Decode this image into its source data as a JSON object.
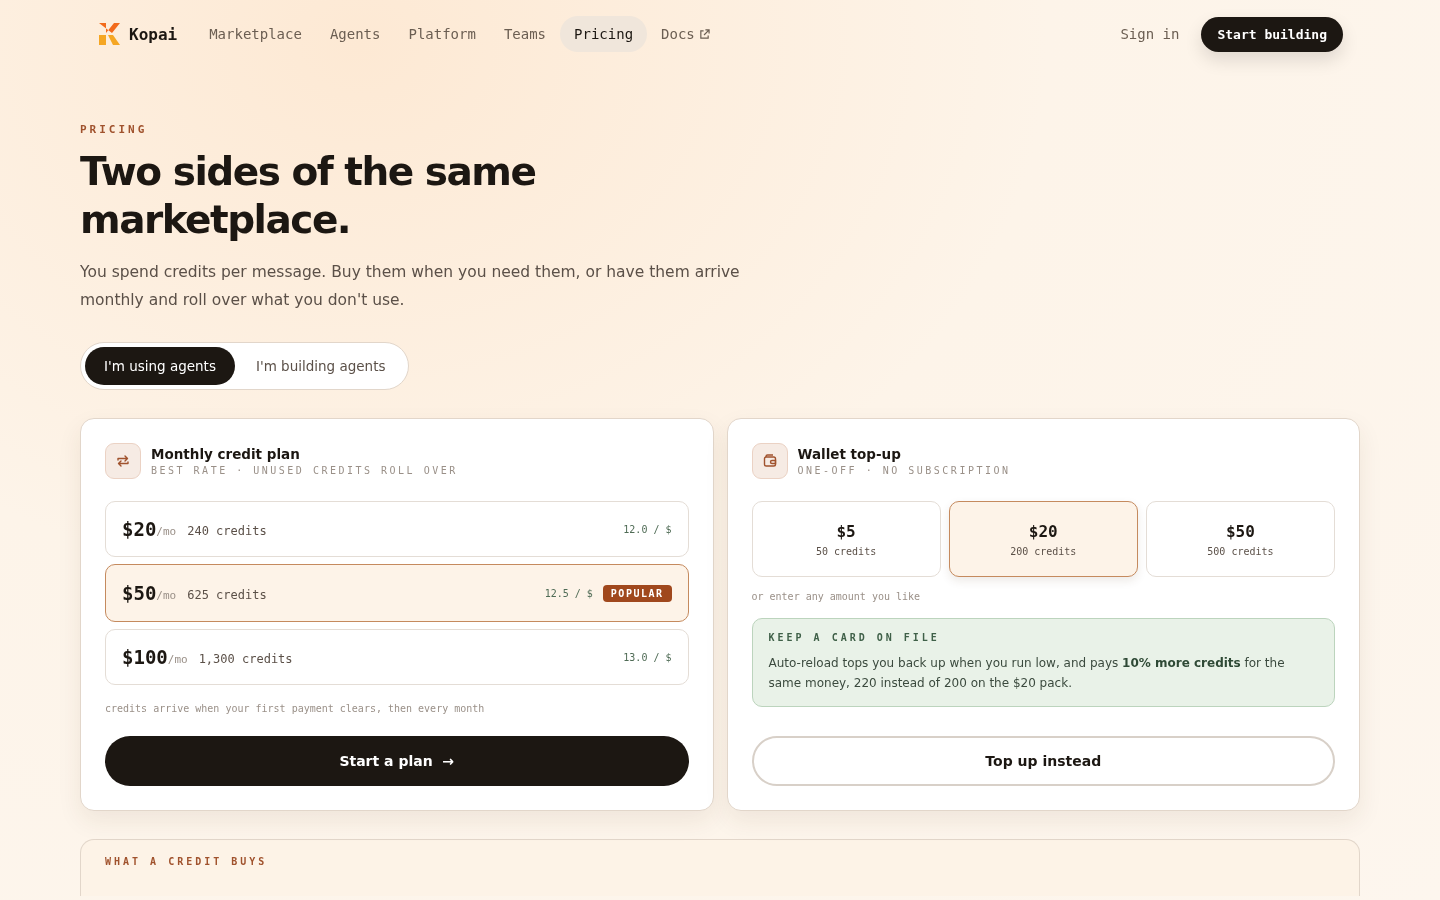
{
  "nav": {
    "brand": "Kopai",
    "links": [
      {
        "label": "Marketplace",
        "selected": false,
        "external": false
      },
      {
        "label": "Agents",
        "selected": false,
        "external": false
      },
      {
        "label": "Platform",
        "selected": false,
        "external": false
      },
      {
        "label": "Teams",
        "selected": false,
        "external": false
      },
      {
        "label": "Pricing",
        "selected": true,
        "external": false
      },
      {
        "label": "Docs",
        "selected": false,
        "external": true
      }
    ],
    "sign_in": "Sign in",
    "cta": "Start building"
  },
  "hero": {
    "eyebrow": "PRICING",
    "title": "Two sides of the same marketplace.",
    "lead": "You spend credits per message. Buy them when you need them, or have them arrive monthly and roll over what you don't use."
  },
  "audience_tabs": [
    {
      "label": "I'm using agents",
      "selected": true
    },
    {
      "label": "I'm building agents",
      "selected": false
    }
  ],
  "plan_card": {
    "title": "Monthly credit plan",
    "subtitle": "BEST RATE · UNUSED CREDITS ROLL OVER",
    "plans": [
      {
        "price": "$20",
        "period": "/mo",
        "credits": "240 credits",
        "rate": "12.0 / $",
        "selected": false
      },
      {
        "price": "$50",
        "period": "/mo",
        "credits": "625 credits",
        "rate": "12.5 / $",
        "badge": "POPULAR",
        "selected": true
      },
      {
        "price": "$100",
        "period": "/mo",
        "credits": "1,300 credits",
        "rate": "13.0 / $",
        "selected": false
      }
    ],
    "note": "credits arrive when your first payment clears, then every month",
    "button": "Start a plan",
    "button_arrow": "→"
  },
  "wallet_card": {
    "title": "Wallet top-up",
    "subtitle": "ONE-OFF · NO SUBSCRIPTION",
    "packs": [
      {
        "price": "$5",
        "credits": "50 credits",
        "selected": false
      },
      {
        "price": "$20",
        "credits": "200 credits",
        "selected": true
      },
      {
        "price": "$50",
        "credits": "500 credits",
        "selected": false
      }
    ],
    "note": "or enter any amount you like",
    "callout": {
      "title": "KEEP A CARD ON FILE",
      "text": "Auto-reload tops you back up when you run low, and pays **10% more credits** for the same money, 220 instead of 200 on the $20 pack."
    },
    "button": "Top up instead"
  },
  "next_section": {
    "eyebrow": "WHAT A CREDIT BUYS"
  }
}
